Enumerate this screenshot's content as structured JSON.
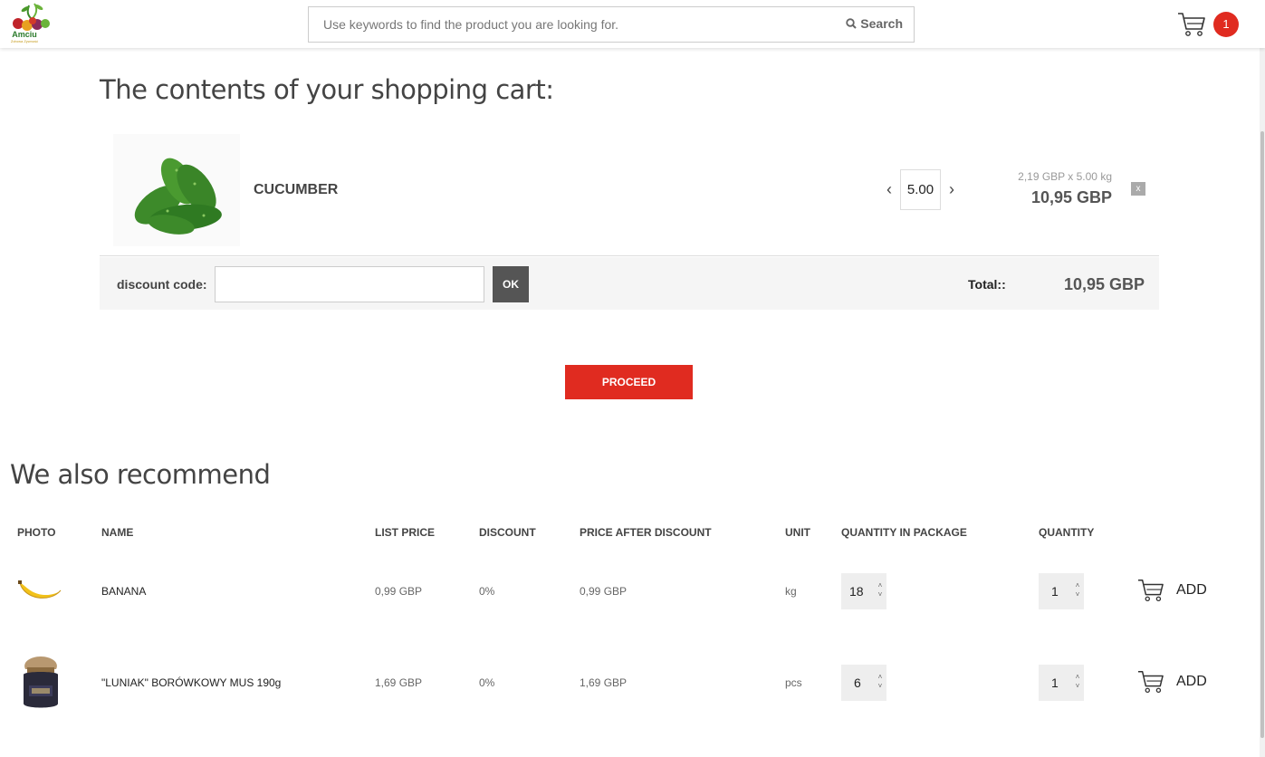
{
  "header": {
    "logo_text": "Amciu",
    "logo_sub": "Zdrowa Żywność",
    "search_placeholder": "Use keywords to find the product you are looking for.",
    "search_label": "Search",
    "cart_count": "1"
  },
  "cart": {
    "title": "The contents of your shopping cart:",
    "item": {
      "name": "CUCUMBER",
      "quantity": "5.00",
      "unit_price_line": "2,19 GBP x 5.00 kg",
      "line_total": "10,95 GBP",
      "remove_label": "x"
    },
    "discount_label": "discount code:",
    "discount_ok": "OK",
    "total_label": "Total::",
    "total_value": "10,95 GBP",
    "proceed": "PROCEED"
  },
  "recommend": {
    "title": "We also recommend",
    "headers": {
      "photo": "PHOTO",
      "name": "NAME",
      "list_price": "LIST PRICE",
      "discount": "DISCOUNT",
      "price_after": "PRICE AFTER DISCOUNT",
      "unit": "UNIT",
      "qty_package": "QUANTITY IN PACKAGE",
      "quantity": "QUANTITY"
    },
    "rows": [
      {
        "name": "BANANA",
        "list_price": "0,99 GBP",
        "discount": "0%",
        "price_after": "0,99 GBP",
        "unit": "kg",
        "qty_package": "18",
        "quantity": "1",
        "add": "ADD"
      },
      {
        "name": "\"LUNIAK\" BORÓWKOWY MUS 190g",
        "list_price": "1,69 GBP",
        "discount": "0%",
        "price_after": "1,69 GBP",
        "unit": "pcs",
        "qty_package": "6",
        "quantity": "1",
        "add": "ADD"
      }
    ]
  },
  "colors": {
    "accent": "#e02b20",
    "dark_button": "#555555"
  }
}
